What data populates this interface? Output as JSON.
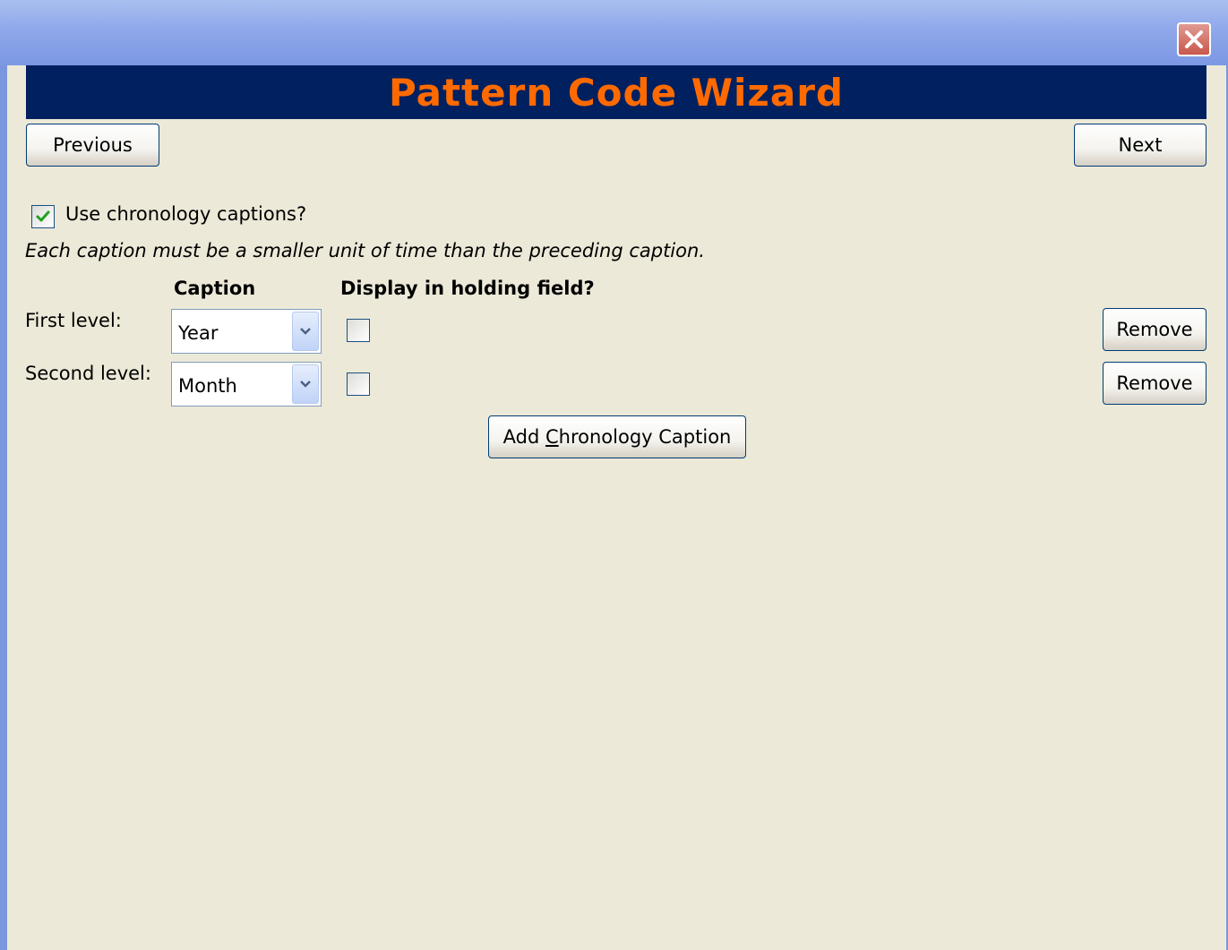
{
  "window": {
    "close_icon": "close-icon"
  },
  "banner": {
    "title": "Pattern Code Wizard"
  },
  "nav": {
    "previous_label": "Previous",
    "next_label": "Next"
  },
  "chronology": {
    "use_captions_label": "Use chronology captions?",
    "use_captions_checked": true,
    "hint": "Each caption must be a smaller unit of time than the preceding caption.",
    "col_caption": "Caption",
    "col_display": "Display in holding field?",
    "rows": [
      {
        "level_label": "First level:",
        "caption": "Year",
        "display_checked": false,
        "remove_label": "Remove"
      },
      {
        "level_label": "Second level:",
        "caption": "Month",
        "display_checked": false,
        "remove_label": "Remove"
      }
    ],
    "add_button": {
      "prefix": "Add ",
      "mnemonic": "C",
      "suffix": "hronology Caption"
    }
  },
  "colors": {
    "banner_bg": "#002060",
    "banner_text": "#ff6a00",
    "window_bg": "#ece9d8",
    "check_green": "#21a121"
  }
}
